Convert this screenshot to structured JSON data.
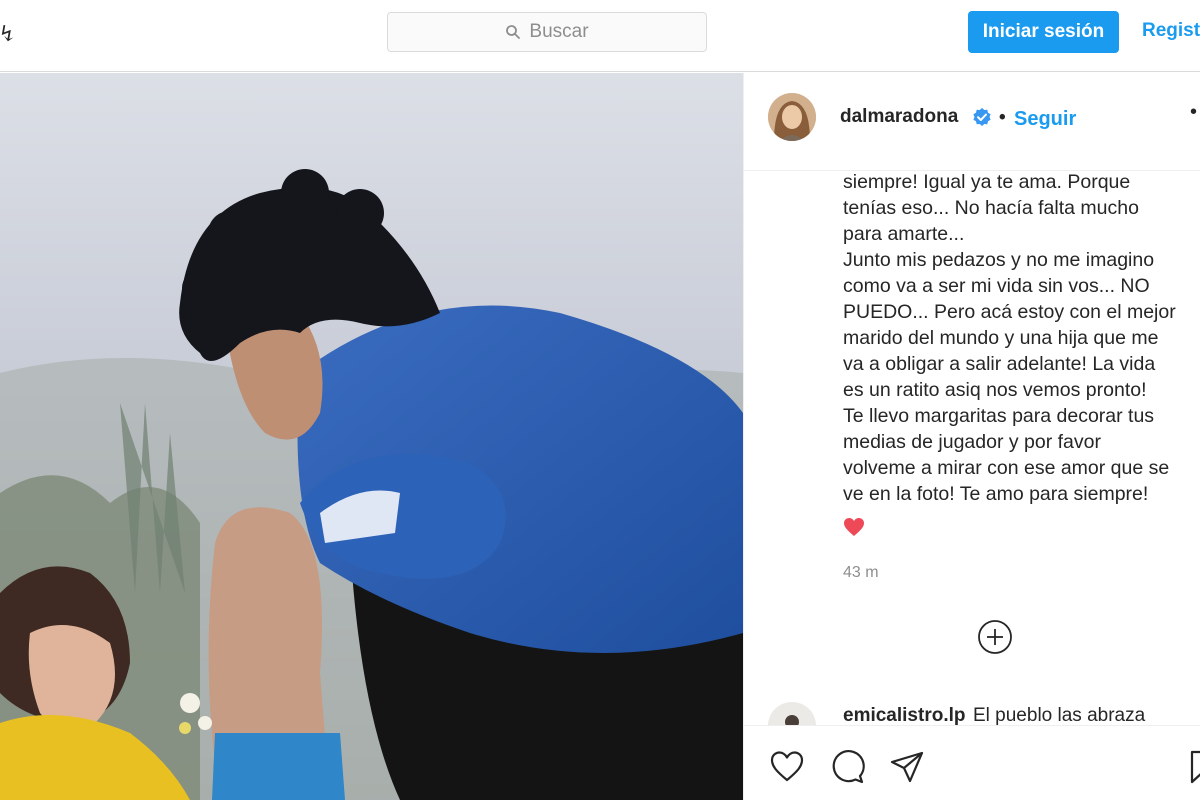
{
  "header": {
    "search": {
      "placeholder": "Buscar",
      "icon": "search-icon"
    },
    "login_label": "Iniciar sesión",
    "register_label": "Registrarte"
  },
  "post": {
    "username": "dalmaradona",
    "verified_icon": "verified-badge-icon",
    "separator": "•",
    "follow_label": "Seguir",
    "caption": "siempre! Igual ya te ama. Porque\ntenías eso... No hacía falta mucho\npara amarte...\nJunto mis pedazos y no me imagino\ncomo va a ser mi vida sin vos... NO\nPUEDO... Pero acá estoy con el mejor\nmarido del mundo y una hija que me\nva a obligar a salir adelante! La vida\nes un ratito asiq nos vemos pronto!\nTe llevo margaritas para decorar tus\nmedias de jugador y por favor\nvolveme a mirar con ese amor que se\nve en la foto! Te amo para siempre!",
    "emoji": "heart-emoji",
    "timestamp": "43 m",
    "load_more_icon": "plus-circle-icon",
    "comment": {
      "user": "emicalistro.lp",
      "text": "El pueblo las abraza"
    }
  },
  "actions": [
    "heart-icon",
    "comment-icon",
    "share-icon",
    "bookmark-icon"
  ],
  "colors": {
    "accent": "#1a9bf0",
    "text": "#262626",
    "muted": "#8e8e8e",
    "border": "#dbdbdb",
    "heart": "#ed4956"
  }
}
